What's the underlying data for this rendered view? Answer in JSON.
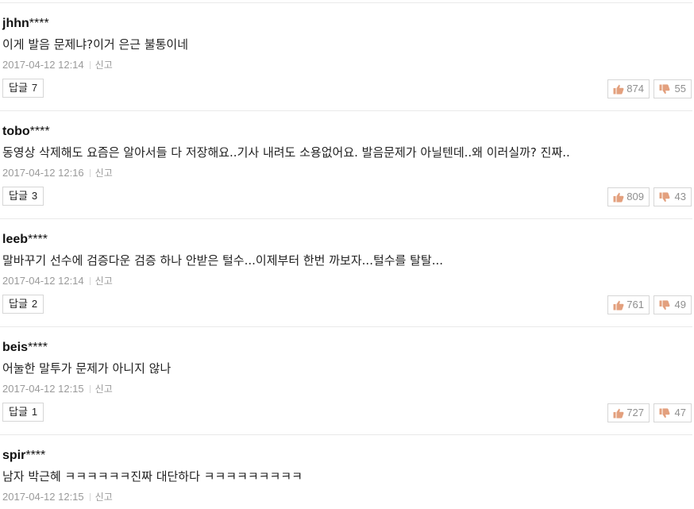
{
  "comments": [
    {
      "author": "jhhn",
      "author_mask": "****",
      "text": "이게 발음 문제냐?이거 은근 불통이네",
      "datetime": "2017-04-12 12:14",
      "report_label": "신고",
      "reply_label": "답글",
      "reply_count": "7",
      "likes": "874",
      "dislikes": "55"
    },
    {
      "author": "tobo",
      "author_mask": "****",
      "text": "동영상 삭제해도 요즘은 알아서들 다 저장해요..기사 내려도 소용없어요. 발음문제가 아닐텐데..왜 이러실까? 진짜..",
      "datetime": "2017-04-12 12:16",
      "report_label": "신고",
      "reply_label": "답글",
      "reply_count": "3",
      "likes": "809",
      "dislikes": "43"
    },
    {
      "author": "leeb",
      "author_mask": "****",
      "text": "말바꾸기 선수에 검증다운 검증 하나 안받은 털수...이제부터 한번 까보자...털수를 탈탈...",
      "datetime": "2017-04-12 12:14",
      "report_label": "신고",
      "reply_label": "답글",
      "reply_count": "2",
      "likes": "761",
      "dislikes": "49"
    },
    {
      "author": "beis",
      "author_mask": "****",
      "text": "어눌한 말투가 문제가 아니지 않나",
      "datetime": "2017-04-12 12:15",
      "report_label": "신고",
      "reply_label": "답글",
      "reply_count": "1",
      "likes": "727",
      "dislikes": "47"
    },
    {
      "author": "spir",
      "author_mask": "****",
      "text": "남자 박근혜 ㅋㅋㅋㅋㅋㅋ진짜 대단하다 ㅋㅋㅋㅋㅋㅋㅋㅋㅋ",
      "datetime": "2017-04-12 12:15",
      "report_label": "신고"
    }
  ],
  "icons": {
    "like": "thumbs-up-icon",
    "dislike": "thumbs-down-icon"
  },
  "colors": {
    "divider": "#e9e9e9",
    "meta_text": "#9a9a9a",
    "thumb_icon": "#e3a07e",
    "vote_count": "#8f8f8f"
  }
}
